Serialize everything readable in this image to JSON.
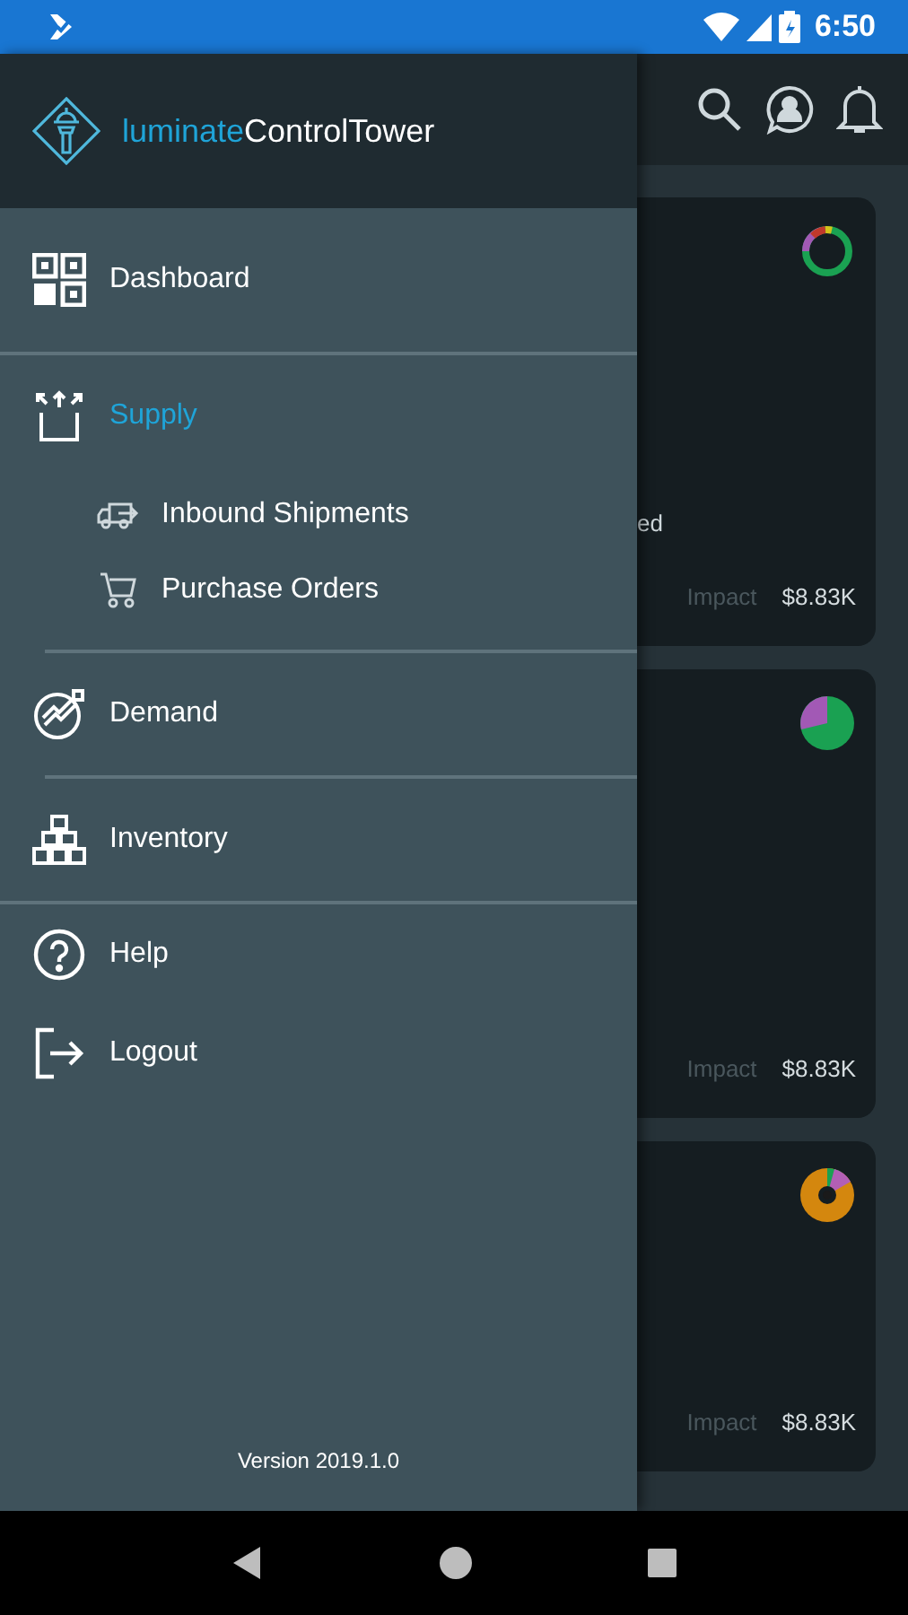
{
  "status_bar": {
    "time": "6:50"
  },
  "drawer": {
    "brand": {
      "prefix": "luminate",
      "name": "ControlTower"
    },
    "items": [
      {
        "label": "Dashboard",
        "selected": false,
        "rule_below": true,
        "rule_inset": false
      },
      {
        "label": "Supply",
        "selected": true,
        "rule_below": true,
        "rule_inset": true,
        "children": [
          {
            "label": "Inbound Shipments",
            "selected": false
          },
          {
            "label": "Purchase Orders",
            "selected": false
          }
        ]
      },
      {
        "label": "Demand",
        "selected": false,
        "rule_below": true,
        "rule_inset": true
      },
      {
        "label": "Inventory",
        "selected": false,
        "rule_below": true,
        "rule_inset": false
      },
      {
        "label": "Help",
        "selected": false,
        "rule_below": false
      },
      {
        "label": "Logout",
        "selected": false,
        "rule_below": false
      }
    ],
    "version": "Version 2019.1.0"
  },
  "cards": [
    {
      "kind": "ring",
      "text_fragment": "ed",
      "impact_label": "Impact",
      "impact": "$8.83K"
    },
    {
      "kind": "pie",
      "impact_label": "Impact",
      "impact": "$8.83K"
    },
    {
      "kind": "donut",
      "impact_label": "Impact",
      "impact": "$8.83K"
    }
  ]
}
